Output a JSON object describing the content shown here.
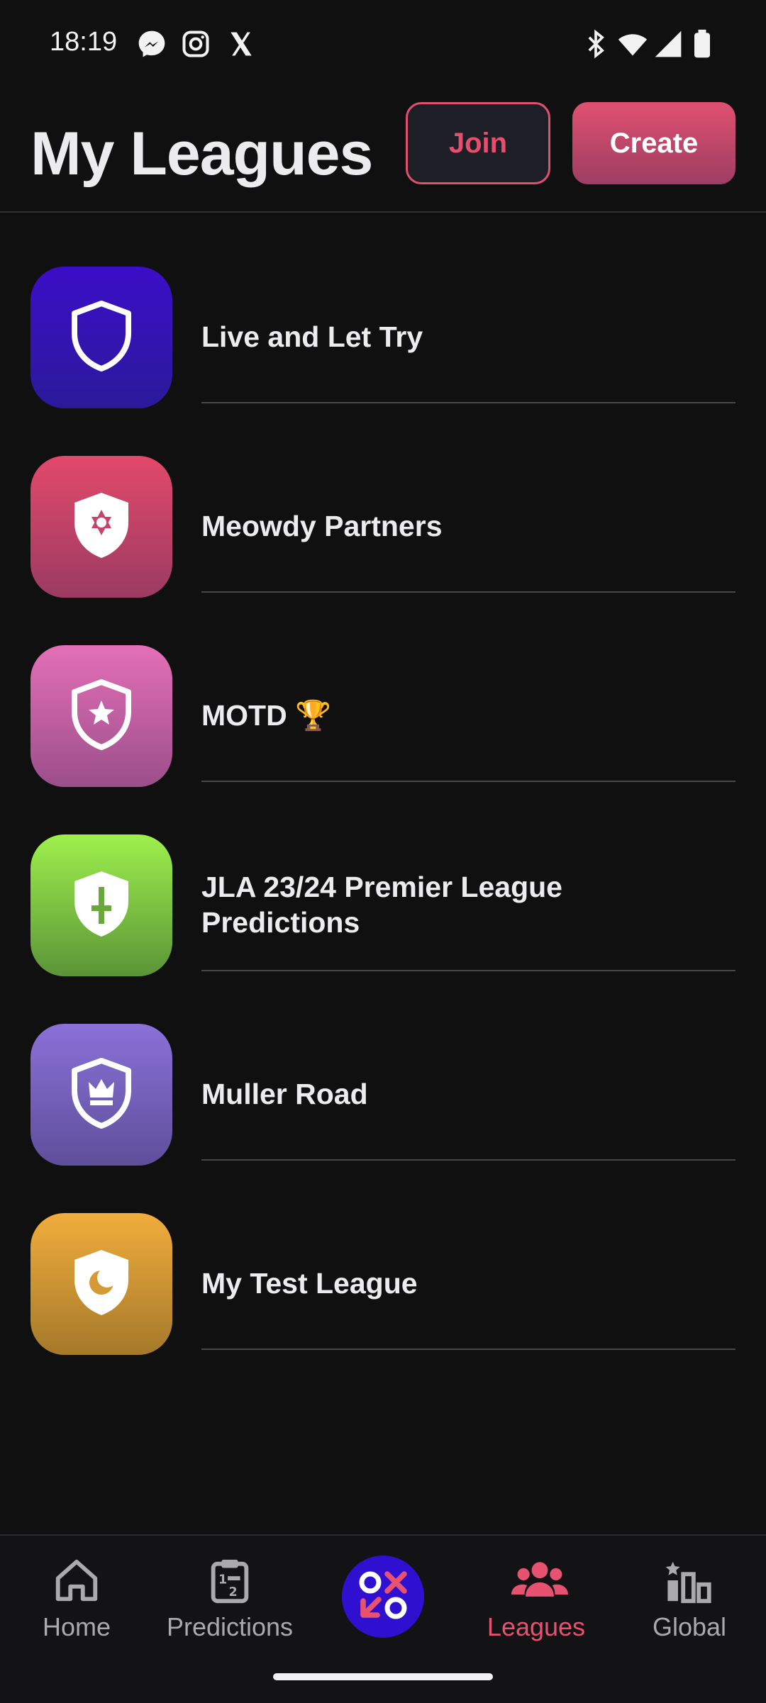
{
  "status_bar": {
    "time": "18:19",
    "left_icons": [
      "messenger-icon",
      "instagram-icon",
      "x-icon"
    ],
    "right_icons": [
      "bluetooth-icon",
      "wifi-icon",
      "signal-icon",
      "battery-icon"
    ]
  },
  "header": {
    "title": "My Leagues",
    "join_label": "Join",
    "create_label": "Create"
  },
  "leagues": [
    {
      "name": "Live and Let Try",
      "icon": "shield-icon",
      "color_top": "#3b0ec8",
      "color_bottom": "#2a1a9a"
    },
    {
      "name": "Meowdy Partners",
      "icon": "shield-star-of-david-icon",
      "color_top": "#e3496a",
      "color_bottom": "#9c3b62"
    },
    {
      "name": "MOTD 🏆",
      "icon": "shield-star-icon",
      "color_top": "#e46fb7",
      "color_bottom": "#9b4f8a"
    },
    {
      "name": "JLA 23/24 Premier League Predictions",
      "icon": "shield-sword-icon",
      "color_top": "#9ef04d",
      "color_bottom": "#5b9437"
    },
    {
      "name": "Muller Road",
      "icon": "shield-crown-icon",
      "color_top": "#8a71d8",
      "color_bottom": "#5e4f9a"
    },
    {
      "name": "My Test League",
      "icon": "shield-moon-icon",
      "color_top": "#f0ad3c",
      "color_bottom": "#a5792a"
    }
  ],
  "nav": {
    "items": [
      {
        "label": "Home",
        "icon": "home-icon"
      },
      {
        "label": "Predictions",
        "icon": "clipboard-icon"
      },
      {
        "label": "",
        "icon": "tic-tac-toe-icon"
      },
      {
        "label": "Leagues",
        "icon": "group-icon"
      },
      {
        "label": "Global",
        "icon": "leaderboard-icon"
      }
    ],
    "active": "Leagues",
    "accent": "#e6526f"
  }
}
